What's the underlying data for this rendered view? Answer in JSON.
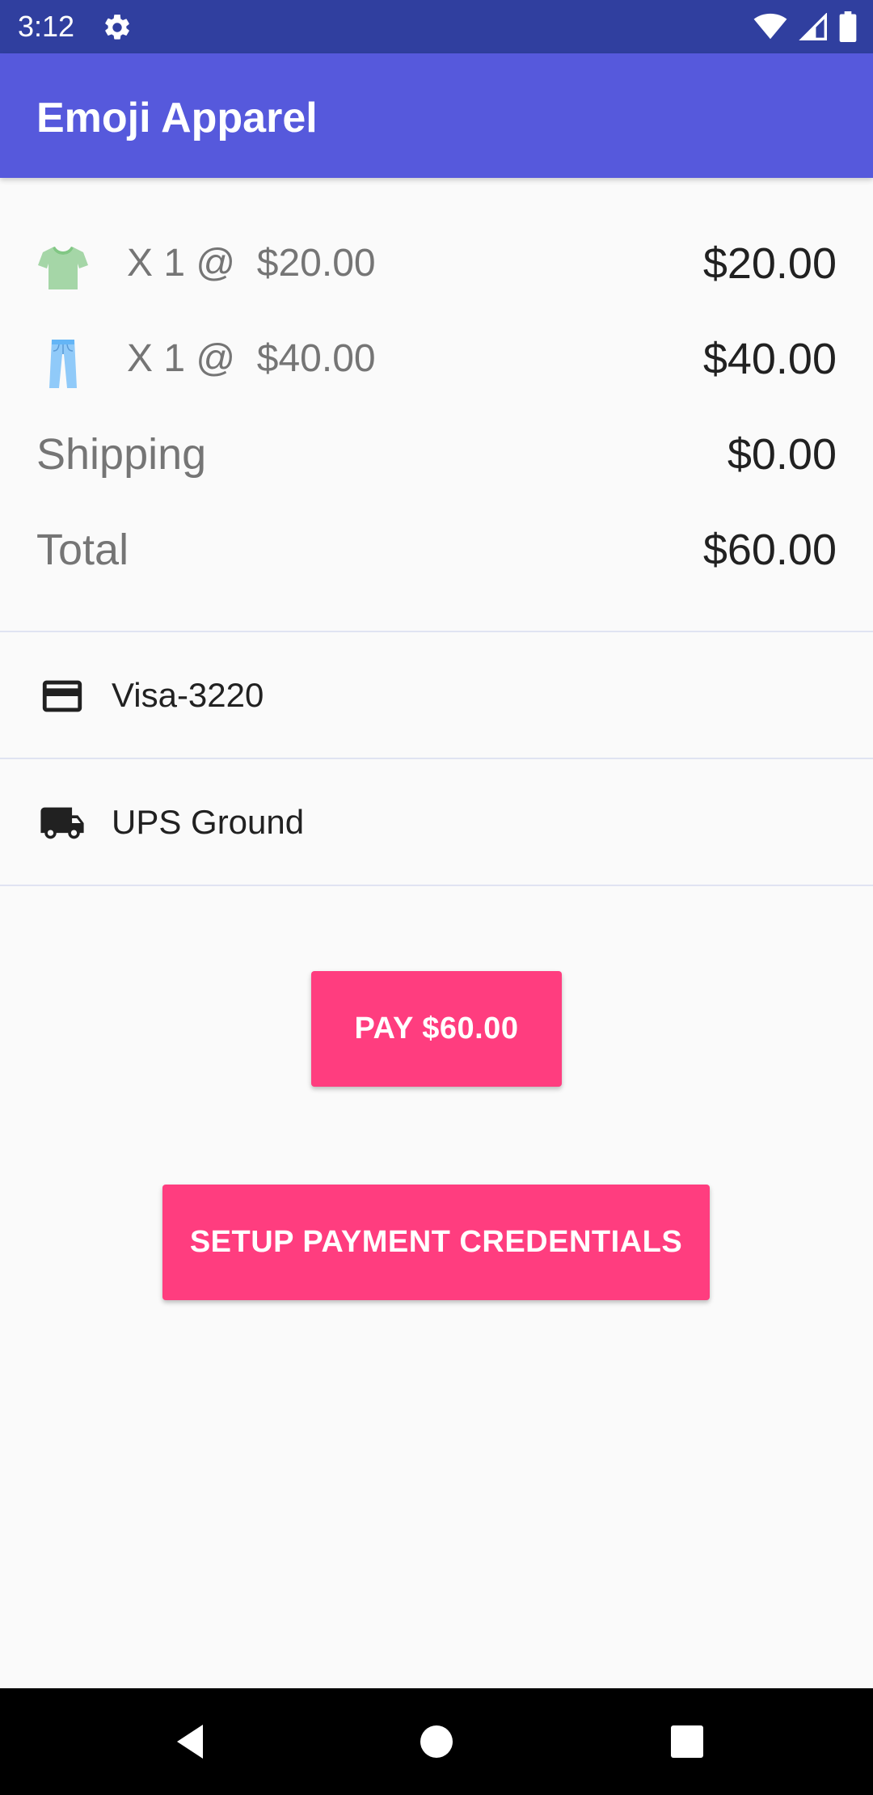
{
  "status_bar": {
    "time": "3:12",
    "icons": [
      "gear-icon",
      "wifi-icon",
      "signal-icon",
      "battery-icon"
    ],
    "background": "#303f9f"
  },
  "app_bar": {
    "title": "Emoji Apparel",
    "background": "#5659dc"
  },
  "order": {
    "items": [
      {
        "icon": "tshirt-emoji-icon",
        "qty_text": "X 1 @  $20.00",
        "total": "$20.00"
      },
      {
        "icon": "jeans-emoji-icon",
        "qty_text": "X 1 @  $40.00",
        "total": "$40.00"
      }
    ],
    "shipping": {
      "label": "Shipping",
      "value": "$0.00"
    },
    "total": {
      "label": "Total",
      "value": "$60.00"
    }
  },
  "payment_method": {
    "icon": "credit-card-icon",
    "label": "Visa-3220"
  },
  "shipping_option": {
    "icon": "truck-icon",
    "label": "UPS Ground"
  },
  "actions": {
    "pay_label": "PAY $60.00",
    "setup_label": "SETUP PAYMENT CREDENTIALS",
    "accent": "#ff3d7f"
  },
  "nav_bar": {
    "icons": [
      "back-icon",
      "home-icon",
      "recents-icon"
    ]
  }
}
